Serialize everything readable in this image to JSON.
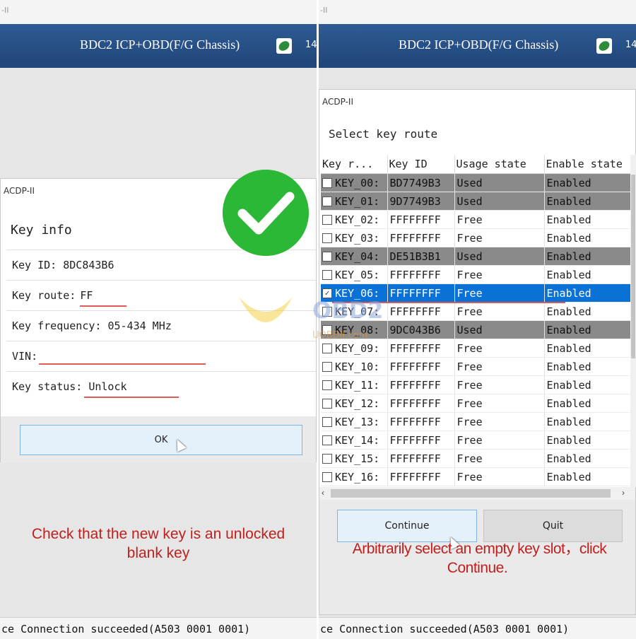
{
  "left": {
    "window_tab": "-II",
    "header_title": "BDC2 ICP+OBD(F/G Chassis)",
    "header_number": "14",
    "dialog": {
      "caption": "ACDP-II",
      "title": "Key info",
      "key_id": "Key ID: 8DC843B6",
      "key_route_label": "Key route:",
      "key_route_value": "FF",
      "key_frequency": "Key frequency: 05-434 MHz",
      "vin_label": "VIN:",
      "key_status_label": "Key status:",
      "key_status_value": "Unlock",
      "ok_label": "OK"
    },
    "caption_line1": "Check that the new key is an unlocked",
    "caption_line2": "blank key",
    "status": "ce Connection succeeded(A503 0001 0001)"
  },
  "right": {
    "window_tab": "-II",
    "header_title": "BDC2 ICP+OBD(F/G Chassis)",
    "header_number": "14",
    "dialog": {
      "caption": "ACDP-II",
      "label": "Select key route",
      "columns": [
        "Key r...",
        "Key ID",
        "Usage state",
        "Enable state"
      ],
      "rows": [
        {
          "route": "KEY_00:",
          "id": "BD7749B3",
          "usage": "Used",
          "enable": "Enabled",
          "checked": false,
          "state": "used"
        },
        {
          "route": "KEY_01:",
          "id": "9D7749B3",
          "usage": "Used",
          "enable": "Enabled",
          "checked": false,
          "state": "used"
        },
        {
          "route": "KEY_02:",
          "id": "FFFFFFFF",
          "usage": "Free",
          "enable": "Enabled",
          "checked": false,
          "state": "free"
        },
        {
          "route": "KEY_03:",
          "id": "FFFFFFFF",
          "usage": "Free",
          "enable": "Enabled",
          "checked": false,
          "state": "free"
        },
        {
          "route": "KEY_04:",
          "id": "DE51B3B1",
          "usage": "Used",
          "enable": "Enabled",
          "checked": false,
          "state": "used"
        },
        {
          "route": "KEY_05:",
          "id": "FFFFFFFF",
          "usage": "Free",
          "enable": "Enabled",
          "checked": false,
          "state": "free"
        },
        {
          "route": "KEY_06:",
          "id": "FFFFFFFF",
          "usage": "Free",
          "enable": "Enabled",
          "checked": true,
          "state": "selected"
        },
        {
          "route": "KEY_07:",
          "id": "FFFFFFFF",
          "usage": "Free",
          "enable": "Enabled",
          "checked": false,
          "state": "free"
        },
        {
          "route": "KEY_08:",
          "id": "9DC043B6",
          "usage": "Used",
          "enable": "Enabled",
          "checked": false,
          "state": "used"
        },
        {
          "route": "KEY_09:",
          "id": "FFFFFFFF",
          "usage": "Free",
          "enable": "Enabled",
          "checked": false,
          "state": "free"
        },
        {
          "route": "KEY_10:",
          "id": "FFFFFFFF",
          "usage": "Free",
          "enable": "Enabled",
          "checked": false,
          "state": "free"
        },
        {
          "route": "KEY_11:",
          "id": "FFFFFFFF",
          "usage": "Free",
          "enable": "Enabled",
          "checked": false,
          "state": "free"
        },
        {
          "route": "KEY_12:",
          "id": "FFFFFFFF",
          "usage": "Free",
          "enable": "Enabled",
          "checked": false,
          "state": "free"
        },
        {
          "route": "KEY_13:",
          "id": "FFFFFFFF",
          "usage": "Free",
          "enable": "Enabled",
          "checked": false,
          "state": "free"
        },
        {
          "route": "KEY_14:",
          "id": "FFFFFFFF",
          "usage": "Free",
          "enable": "Enabled",
          "checked": false,
          "state": "free"
        },
        {
          "route": "KEY_15:",
          "id": "FFFFFFFF",
          "usage": "Free",
          "enable": "Enabled",
          "checked": false,
          "state": "free"
        },
        {
          "route": "KEY_16:",
          "id": "FFFFFFFF",
          "usage": "Free",
          "enable": "Enabled",
          "checked": false,
          "state": "free"
        }
      ],
      "continue_label": "Continue",
      "quit_label": "Quit"
    },
    "caption_line1": "Arbitrarily select an empty key slot，click",
    "caption_line2": "Continue.",
    "status": "ce Connection succeeded(A503 0001 0001)"
  },
  "watermark": {
    "brand": "OBD2",
    "domain": "UOBDII.com"
  },
  "colors": {
    "header": "#1f4579",
    "selected_row": "#0a72d6",
    "used_row": "#8a8a8a",
    "caption_red": "#c0201d",
    "check_green": "#2bb836",
    "underline_red": "#e05a57"
  },
  "icons": {
    "app_badge": "leaf-badge-icon",
    "success": "checkmark-icon",
    "pointer": "mouse-cursor-icon"
  }
}
